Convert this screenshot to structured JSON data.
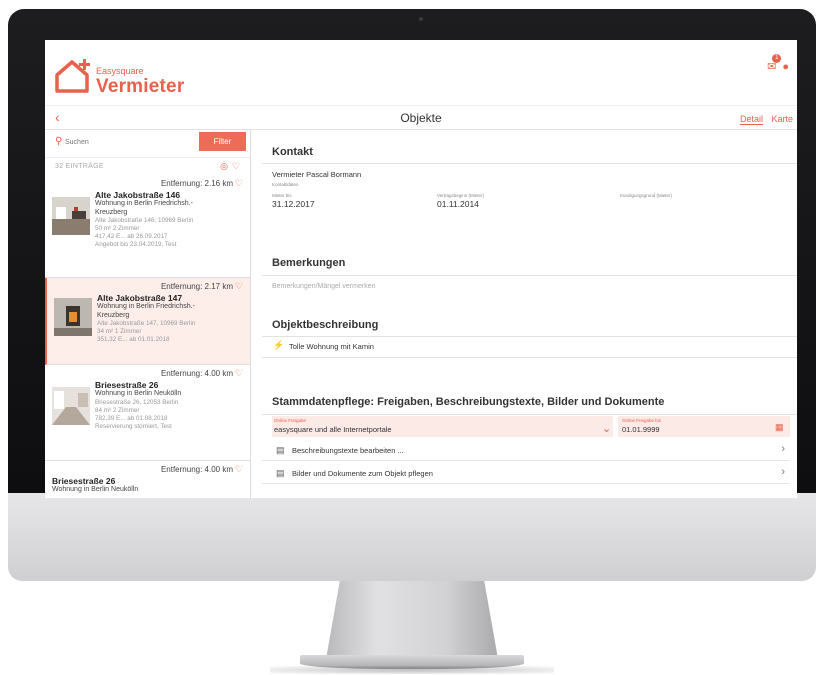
{
  "app": {
    "brand_small": "Easysquare",
    "brand_big": "Vermieter",
    "accent": "#e9604c",
    "notification_count": "1"
  },
  "nav": {
    "title": "Objekte",
    "tabs": [
      {
        "label": "Detail",
        "active": true
      },
      {
        "label": "Karte",
        "active": false
      }
    ]
  },
  "sidebar": {
    "search_placeholder": "Suchen",
    "filter_label": "Filter",
    "count_label": "32 EINTRÄGE",
    "items": [
      {
        "distance": "Entfernung: 2.16 km",
        "title": "Alte Jakobstraße 146",
        "subtitle": "Wohnung in Berlin Friedrichsh.-",
        "subtitle2": "Kreuzberg",
        "meta": [
          "Alte Jakobstraße 146, 10969 Berlin",
          "50 m²    2 Zimmer",
          "417,42 E... ab 26.09.2017",
          "Angebot bis 23.04.2019, Test"
        ],
        "selected": false
      },
      {
        "distance": "Entfernung: 2.17 km",
        "title": "Alte Jakobstraße 147",
        "subtitle": "Wohnung in Berlin Friedrichsh.-",
        "subtitle2": "Kreuzberg",
        "meta": [
          "Alte Jakobstraße 147, 10969 Berlin",
          "34 m²    1 Zimmer",
          "351,32 E... ab 01.01.2018"
        ],
        "selected": true
      },
      {
        "distance": "Entfernung: 4.00 km",
        "title": "Briesestraße 26",
        "subtitle": "Wohnung in Berlin Neukölln",
        "subtitle2": "",
        "meta": [
          "Briesestraße 26, 12053 Berlin",
          "84 m²    2 Zimmer",
          "782,39 E... ab 01.08.2018",
          "Reservierung storniert, Test"
        ],
        "selected": false
      },
      {
        "distance": "Entfernung: 4.00 km",
        "title": "Briesestraße 26",
        "subtitle": "Wohnung in Berlin Neukölln",
        "subtitle2": "",
        "meta": [],
        "selected": false
      }
    ]
  },
  "detail": {
    "kontakt_title": "Kontakt",
    "vermieter": "Vermieter Pascal Bormann",
    "kontaktdaten_label": "Kontaktdaten",
    "mieter_bis_label": "Mieter bis",
    "mieter_bis": "31.12.2017",
    "vertragsbeginn_label": "Vertragsbeginn (Mieter)",
    "vertragsbeginn": "01.11.2014",
    "kuendigung_label": "Kündigungsgrund (Mieter)",
    "bemerkungen_title": "Bemerkungen",
    "bemerkungen_placeholder": "Bemerkungen/Mängel vermerken",
    "objekt_title": "Objektbeschreibung",
    "objekt_item": "Tolle Wohnung mit Kamin",
    "stamm_title": "Stammdatenpflege: Freigaben, Beschreibungstexte, Bilder und Dokumente",
    "online_freigabe_label": "Online Freigabe",
    "online_freigabe_value": "easysquare und alle Internetportale",
    "online_bis_label": "Online Freigabe bis",
    "online_bis_value": "01.01.9999",
    "links": [
      "Beschreibungstexte bearbeiten ...",
      "Bilder und Dokumente zum Objekt pflegen"
    ]
  }
}
